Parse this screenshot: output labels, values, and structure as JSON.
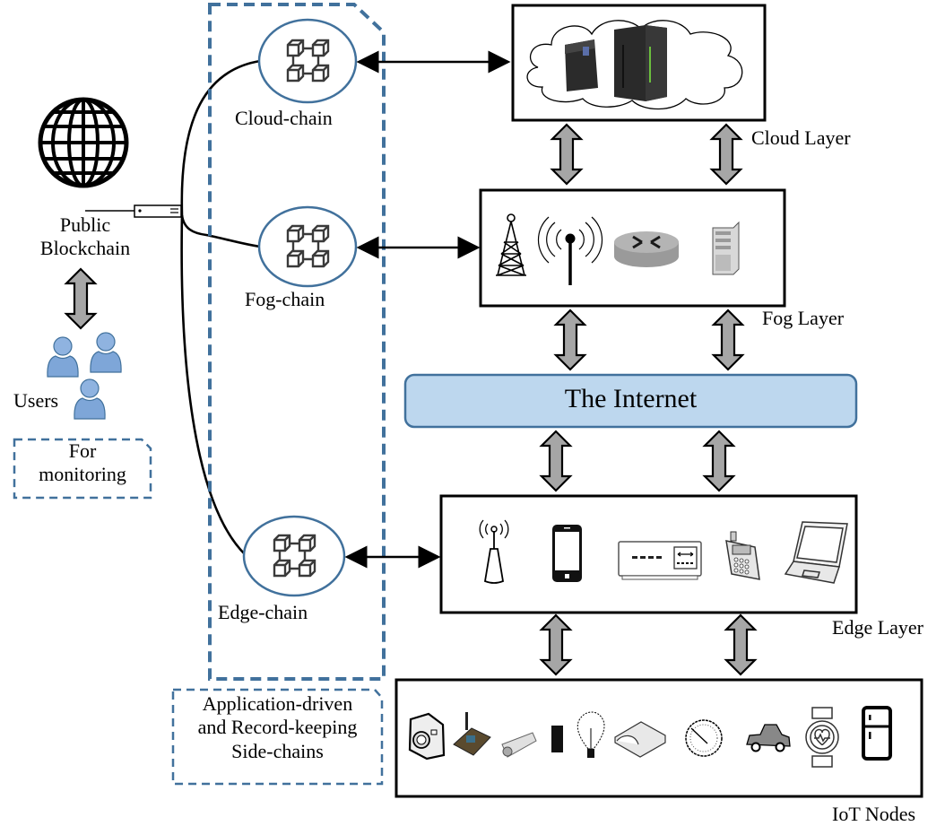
{
  "public_blockchain": {
    "label_line1": "Public",
    "label_line2": "Blockchain"
  },
  "users": {
    "label": "Users"
  },
  "monitoring_note": {
    "line1": "For",
    "line2": "monitoring"
  },
  "side_chains": [
    {
      "id": "cloud",
      "label": "Cloud-chain"
    },
    {
      "id": "fog",
      "label": "Fog-chain"
    },
    {
      "id": "edge",
      "label": "Edge-chain"
    }
  ],
  "side_chains_note": {
    "line1": "Application-driven",
    "line2": "and Record-keeping",
    "line3": "Side-chains"
  },
  "layers": {
    "cloud": {
      "label": "Cloud Layer",
      "icons": [
        "tower-server-icon",
        "mainframe-server-icon"
      ]
    },
    "fog": {
      "label": "Fog Layer",
      "icons": [
        "cell-tower-icon",
        "wireless-antenna-icon",
        "router-icon",
        "rack-server-icon"
      ]
    },
    "internet": {
      "label": "The Internet"
    },
    "edge": {
      "label": "Edge Layer",
      "icons": [
        "wifi-access-point-icon",
        "smartphone-icon",
        "network-switch-icon",
        "handheld-device-icon",
        "laptop-icon"
      ]
    },
    "iot": {
      "label": "IoT Nodes",
      "icons": [
        "camera-icon",
        "sensor-board-icon",
        "cctv-camera-icon",
        "mini-fridge-icon",
        "light-bulb-icon",
        "smart-lock-icon",
        "gauge-meter-icon",
        "car-icon",
        "smartwatch-icon",
        "refrigerator-icon"
      ]
    }
  },
  "colors": {
    "dashed_border": "#41719c",
    "chain_ellipse_stroke": "#41719c",
    "internet_fill": "#bdd7ee",
    "internet_stroke": "#41719c",
    "user_blue": "#7ea6d8",
    "arrow_fill": "#a6a6a6"
  }
}
